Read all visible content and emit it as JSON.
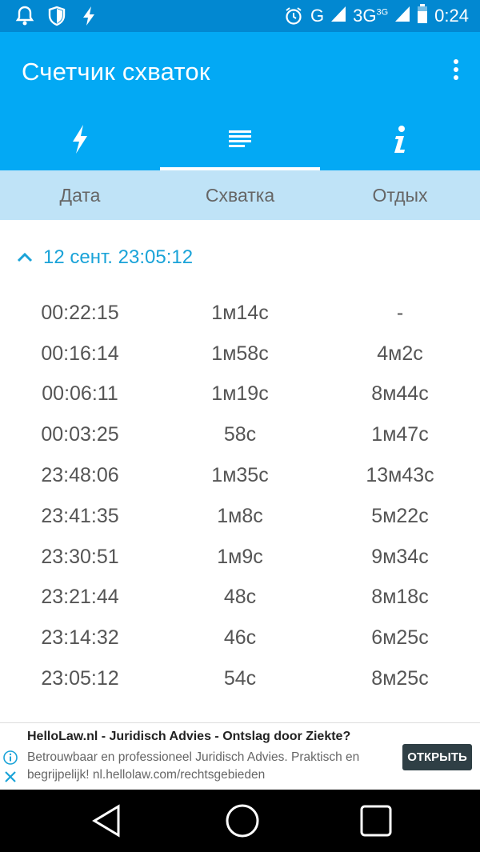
{
  "status_bar": {
    "time": "0:24",
    "network_g": "G",
    "network_3g": "3G",
    "network_3g_sup": "3G",
    "icons": [
      "notification-bell-icon",
      "shield-icon",
      "flash-icon",
      "alarm-clock-icon",
      "signal-icon",
      "battery-icon"
    ]
  },
  "app_bar": {
    "title": "Счетчик схваток"
  },
  "tabs": [
    {
      "icon": "lightning-icon",
      "active": false
    },
    {
      "icon": "list-icon",
      "active": true
    },
    {
      "icon": "info-icon",
      "active": false
    }
  ],
  "table": {
    "headers": [
      "Дата",
      "Схватка",
      "Отдых"
    ],
    "group_label": "12 сент. 23:05:12",
    "rows": [
      [
        "00:22:15",
        "1м14с",
        "-"
      ],
      [
        "00:16:14",
        "1м58с",
        "4м2с"
      ],
      [
        "00:06:11",
        "1м19с",
        "8м44с"
      ],
      [
        "00:03:25",
        "58с",
        "1м47с"
      ],
      [
        "23:48:06",
        "1м35с",
        "13м43с"
      ],
      [
        "23:41:35",
        "1м8с",
        "5м22с"
      ],
      [
        "23:30:51",
        "1м9с",
        "9м34с"
      ],
      [
        "23:21:44",
        "48с",
        "8м18с"
      ],
      [
        "23:14:32",
        "46с",
        "6м25с"
      ],
      [
        "23:05:12",
        "54с",
        "8м25с"
      ]
    ]
  },
  "ad": {
    "title": "HelloLaw.nl - Juridisch Advies - Ontslag door Ziekte?",
    "description": "Betrouwbaar en professioneel Juridisch Advies. Praktisch en begrijpelijk! nl.hellolaw.com/rechtsgebieden",
    "button": "ОТКРЫТЬ"
  },
  "colors": {
    "status_bar": "#0288d1",
    "app_bar": "#03a9f4",
    "header_band": "#bfe3f7",
    "accent_text": "#1aa3d8"
  }
}
